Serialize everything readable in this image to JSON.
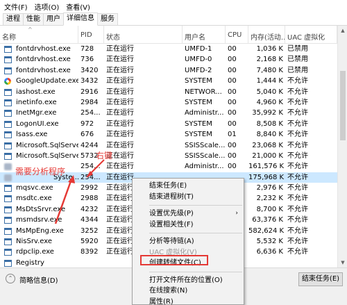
{
  "menu": [
    "文件(F)",
    "选项(O)",
    "查看(V)"
  ],
  "tabs": [
    "进程",
    "性能",
    "用户",
    "详细信息",
    "服务"
  ],
  "active_tab": 3,
  "columns": [
    "名称",
    "PID",
    "状态",
    "用户名",
    "CPU",
    "内存(活动...",
    "UAC 虚拟化"
  ],
  "rows": [
    {
      "name": "fontdrvhost.exe",
      "pid": "728",
      "status": "正在运行",
      "user": "UMFD-1",
      "cpu": "00",
      "mem": "1,036 K",
      "uac": "已禁用",
      "icon": "window"
    },
    {
      "name": "fontdrvhost.exe",
      "pid": "736",
      "status": "正在运行",
      "user": "UMFD-0",
      "cpu": "00",
      "mem": "2,168 K",
      "uac": "已禁用",
      "icon": "window"
    },
    {
      "name": "fontdrvhost.exe",
      "pid": "3420",
      "status": "正在运行",
      "user": "UMFD-2",
      "cpu": "00",
      "mem": "7,480 K",
      "uac": "已禁用",
      "icon": "window"
    },
    {
      "name": "GoogleUpdate.exe",
      "pid": "3432",
      "status": "正在运行",
      "user": "SYSTEM",
      "cpu": "00",
      "mem": "1,444 K",
      "uac": "不允许",
      "icon": "google"
    },
    {
      "name": "iashost.exe",
      "pid": "2916",
      "status": "正在运行",
      "user": "NETWOR...",
      "cpu": "00",
      "mem": "5,040 K",
      "uac": "不允许",
      "icon": "window"
    },
    {
      "name": "inetinfo.exe",
      "pid": "2984",
      "status": "正在运行",
      "user": "SYSTEM",
      "cpu": "00",
      "mem": "4,960 K",
      "uac": "不允许",
      "icon": "window"
    },
    {
      "name": "InetMgr.exe",
      "pid": "254...",
      "status": "正在运行",
      "user": "Administr...",
      "cpu": "00",
      "mem": "35,992 K",
      "uac": "不允许",
      "icon": "window"
    },
    {
      "name": "LogonUI.exe",
      "pid": "972",
      "status": "正在运行",
      "user": "SYSTEM",
      "cpu": "00",
      "mem": "8,508 K",
      "uac": "不允许",
      "icon": "window"
    },
    {
      "name": "lsass.exe",
      "pid": "676",
      "status": "正在运行",
      "user": "SYSTEM",
      "cpu": "01",
      "mem": "8,840 K",
      "uac": "不允许",
      "icon": "window"
    },
    {
      "name": "Microsoft.SqlServe...",
      "pid": "4244",
      "status": "正在运行",
      "user": "SSISScale...",
      "cpu": "00",
      "mem": "23,068 K",
      "uac": "不允许",
      "icon": "window"
    },
    {
      "name": "Microsoft.SqlServe...",
      "pid": "5732",
      "status": "正在运行",
      "user": "SSISScale...",
      "cpu": "00",
      "mem": "21,000 K",
      "uac": "不允许",
      "icon": "window"
    },
    {
      "name": "",
      "pid": "254...",
      "status": "正在运行",
      "user": "Administr...",
      "cpu": "00",
      "mem": "161,576 K",
      "uac": "不允许",
      "icon": "blur"
    },
    {
      "name": "Syste...",
      "pid": "254...",
      "status": "正在运行",
      "user": "",
      "cpu": "",
      "mem": "175,968 K",
      "uac": "不允许",
      "icon": "blur",
      "selected": true
    },
    {
      "name": "mqsvc.exe",
      "pid": "2992",
      "status": "正在运行",
      "user": "",
      "cpu": "",
      "mem": "2,976 K",
      "uac": "不允许",
      "icon": "window"
    },
    {
      "name": "msdtc.exe",
      "pid": "2988",
      "status": "正在运行",
      "user": "",
      "cpu": "",
      "mem": "2,232 K",
      "uac": "不允许",
      "icon": "window"
    },
    {
      "name": "MsDtsSrvr.exe",
      "pid": "4232",
      "status": "正在运行",
      "user": "",
      "cpu": "",
      "mem": "8,700 K",
      "uac": "不允许",
      "icon": "window"
    },
    {
      "name": "msmdsrv.exe",
      "pid": "4344",
      "status": "正在运行",
      "user": "",
      "cpu": "",
      "mem": "63,376 K",
      "uac": "不允许",
      "icon": "window"
    },
    {
      "name": "MsMpEng.exe",
      "pid": "3252",
      "status": "正在运行",
      "user": "",
      "cpu": "",
      "mem": "582,624 K",
      "uac": "不允许",
      "icon": "window"
    },
    {
      "name": "NisSrv.exe",
      "pid": "5920",
      "status": "正在运行",
      "user": "",
      "cpu": "",
      "mem": "5,532 K",
      "uac": "不允许",
      "icon": "window"
    },
    {
      "name": "rdpclip.exe",
      "pid": "8392",
      "status": "正在运行",
      "user": "",
      "cpu": "",
      "mem": "6,636 K",
      "uac": "不允许",
      "icon": "window"
    },
    {
      "name": "Registry",
      "pid": "",
      "status": "",
      "user": "",
      "cpu": "",
      "mem": "",
      "uac": "",
      "icon": "window"
    }
  ],
  "context_menu": [
    {
      "label": "结束任务(E)",
      "disabled": false
    },
    {
      "label": "结束进程树(T)",
      "disabled": false
    },
    {
      "sep": true
    },
    {
      "label": "设置优先级(P)",
      "disabled": false,
      "submenu": true
    },
    {
      "label": "设置相关性(F)",
      "disabled": false
    },
    {
      "sep": true
    },
    {
      "label": "分析等待链(A)",
      "disabled": false
    },
    {
      "label": "UAC 虚拟化(V)",
      "disabled": true
    },
    {
      "label": "创建转储文件(C)",
      "disabled": false,
      "highlighted": true
    },
    {
      "sep": true
    },
    {
      "label": "打开文件所在的位置(O)",
      "disabled": false
    },
    {
      "label": "在线搜索(N)",
      "disabled": false
    },
    {
      "label": "属性(R)",
      "disabled": false
    }
  ],
  "footer": {
    "brief_label": "简略信息(D)",
    "end_task_label": "结束任务(E)"
  },
  "annotations": {
    "right_click": "右键",
    "target": "需要分析程序"
  },
  "colors": {
    "selected_row": "#cce8ff",
    "annotation": "#e53935"
  }
}
